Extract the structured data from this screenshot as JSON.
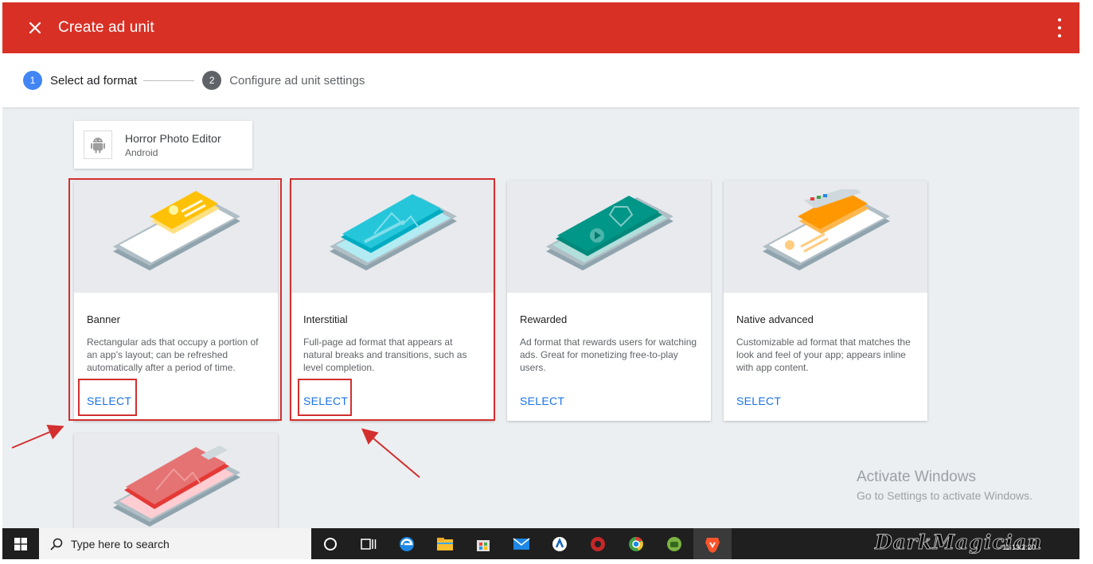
{
  "header": {
    "title": "Create ad unit"
  },
  "steps": [
    {
      "number": "1",
      "label": "Select ad format"
    },
    {
      "number": "2",
      "label": "Configure ad unit settings"
    }
  ],
  "app": {
    "name": "Horror Photo Editor",
    "platform": "Android"
  },
  "formats": [
    {
      "title": "Banner",
      "description": "Rectangular ads that occupy a portion of an app's layout; can be refreshed automatically after a period of time.",
      "action": "SELECT"
    },
    {
      "title": "Interstitial",
      "description": "Full-page ad format that appears at natural breaks and transitions, such as level completion.",
      "action": "SELECT"
    },
    {
      "title": "Rewarded",
      "description": "Ad format that rewards users for watching ads. Great for monetizing free-to-play users.",
      "action": "SELECT"
    },
    {
      "title": "Native advanced",
      "description": "Customizable ad format that matches the look and feel of your app; appears inline with app content.",
      "action": "SELECT"
    }
  ],
  "watermark": {
    "title": "Activate Windows",
    "subtitle": "Go to Settings to activate Windows."
  },
  "taskbar": {
    "search_placeholder": "Type here to search",
    "brand": "DarkMagician",
    "clock": "11:13:2:20",
    "icons": [
      "cortana-icon",
      "task-view-icon",
      "edge-icon",
      "file-explorer-icon",
      "store-icon",
      "mail-icon",
      "app-icon",
      "antivirus-icon",
      "chrome-icon",
      "android-studio-icon",
      "brave-icon"
    ]
  },
  "colors": {
    "brand_red": "#d93025",
    "step_active": "#4285f4",
    "link_blue": "#1a73e8",
    "highlight": "#d32f2f"
  }
}
